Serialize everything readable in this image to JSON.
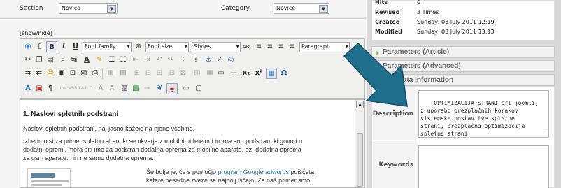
{
  "section": {
    "label": "Section",
    "value": "Novica"
  },
  "category": {
    "label": "Category",
    "value": "Novice"
  },
  "editor": {
    "toggle": "[show/hide]",
    "font_family": "Font family",
    "font_size": "Font size",
    "styles": "Styles",
    "format": "Paragraph",
    "heading": "1. Naslovi spletnih podstrani",
    "para1": "Naslovi spletnih podstrani, naj jasno kažejo na njeno vsebino.",
    "para2_l1": "Izberimo si za primer spletno stran, ki se ukvarja z mobilnimi telefoni in ima eno podstran, ki govori o",
    "para2_l2": "dodatni opremi, mora biti ime za podstran dodatna oprema za mobilne aparate, oz. dodatna oprema",
    "para2_l3": "za gsm aparate... in ne samo dodatna oprema.",
    "para3_pre": "Še bolje je, če s pomočjo ",
    "para3_link": "program Google adwords",
    "para3_post": " poiščeta",
    "para3_l2": "katere besedne zveze se najbolj iščejo. Za naš primer smo"
  },
  "info": {
    "hits_label": "Hits",
    "hits_value": "0",
    "revised_label": "Revised",
    "revised_value": "3 Times",
    "created_label": "Created",
    "created_value": "Sunday, 03 July 2011 12:19",
    "modified_label": "Modified",
    "modified_value": "Sunday, 03 July 2011 13:13"
  },
  "panes": {
    "article": "Parameters (Article)",
    "advanced": "Parameters (Advanced)",
    "metadata": "Metadata Information"
  },
  "metadata": {
    "description_label": "Description",
    "description_value": "OPTIMIZACIJA STRANI pri joomli,\nz uporabo brezplačnih korakov\nsistemske postavitve spletne\nstrani, brezplačna optimizacija\nspletne strani.",
    "keywords_label": "Keywords",
    "keywords_value": ""
  },
  "colors": {
    "arrow": "#1e6e8c",
    "pane_icon": "#8fbf5a",
    "link": "#2a7ab0"
  }
}
